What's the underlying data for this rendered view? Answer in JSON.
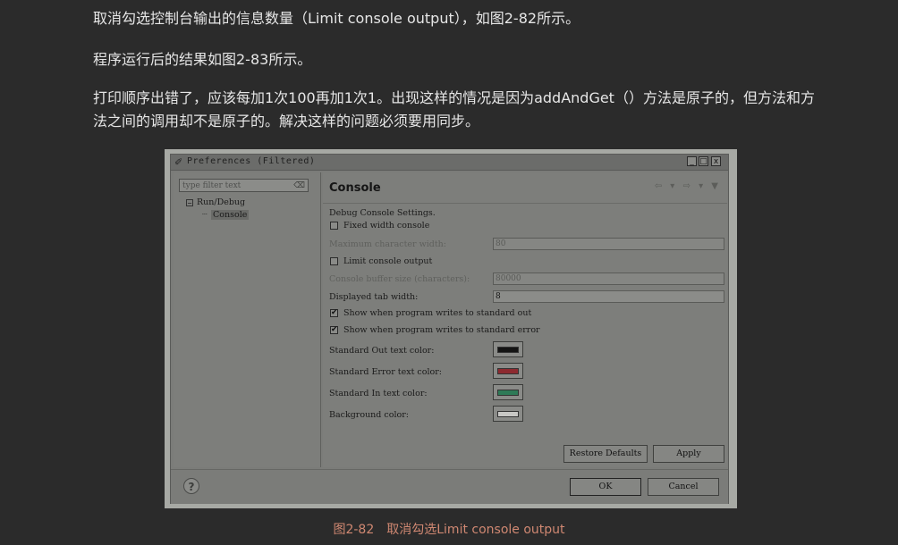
{
  "article": {
    "p1": "取消勾选控制台输出的信息数量（Limit console output），如图2-82所示。",
    "p2": "程序运行后的结果如图2-83所示。",
    "p3": "打印顺序出错了，应该每加1次100再加1次1。出现这样的情况是因为addAndGet（）方法是原子的，但方法和方法之间的调用却不是原子的。解决这样的问题必须要用同步。"
  },
  "window": {
    "title": "Preferences (Filtered)",
    "controls": [
      "_",
      "□",
      "x"
    ]
  },
  "left": {
    "filter_placeholder": "type filter text",
    "tree_root": "Run/Debug",
    "tree_child": "Console",
    "toggle": "−"
  },
  "right": {
    "title": "Console",
    "nav": [
      "⇦",
      "▾",
      "⇨",
      "▾",
      "▼"
    ],
    "section": "Debug Console Settings.",
    "fixed_width": "Fixed width console",
    "max_char_label": "Maximum character width:",
    "max_char_value": "80",
    "limit_output": "Limit console output",
    "buffer_label": "Console buffer size (characters):",
    "buffer_value": "80000",
    "tab_label": "Displayed tab width:",
    "tab_value": "8",
    "show_out": "Show when program writes to standard out",
    "show_err": "Show when program writes to standard error",
    "check_mark": "✔",
    "color_out": "Standard Out text color:",
    "color_err": "Standard Error text color:",
    "color_in": "Standard In text color:",
    "color_bg": "Background color:",
    "restore": "Restore Defaults",
    "apply": "Apply"
  },
  "colors": {
    "out": "#141414",
    "err": "#8d2a30",
    "in": "#2e7a57",
    "bg": "#c8c8c5"
  },
  "bottom": {
    "help": "?",
    "ok": "OK",
    "cancel": "Cancel"
  },
  "caption": "图2-82　取消勾选Limit console output"
}
